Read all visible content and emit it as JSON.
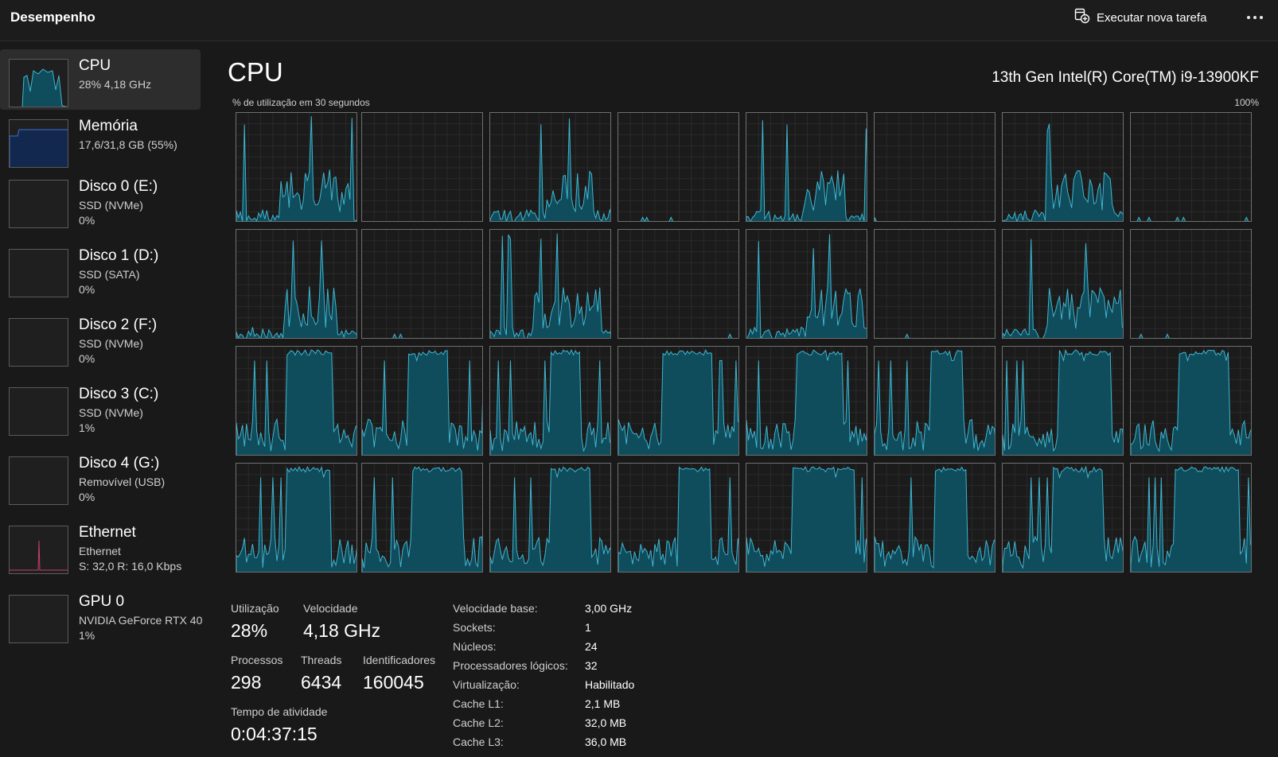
{
  "header": {
    "title": "Desempenho",
    "run_task_label": "Executar nova tarefa"
  },
  "sidebar": {
    "items": [
      {
        "title": "CPU",
        "lines": [
          "28%  4,18 GHz"
        ],
        "selected": true,
        "kind": "cpu"
      },
      {
        "title": "Memória",
        "lines": [
          "17,6/31,8 GB (55%)"
        ],
        "kind": "mem"
      },
      {
        "title": "Disco 0 (E:)",
        "lines": [
          "SSD (NVMe)",
          "0%"
        ],
        "kind": "disk"
      },
      {
        "title": "Disco 1 (D:)",
        "lines": [
          "SSD (SATA)",
          "0%"
        ],
        "kind": "disk"
      },
      {
        "title": "Disco 2 (F:)",
        "lines": [
          "SSD (NVMe)",
          "0%"
        ],
        "kind": "disk"
      },
      {
        "title": "Disco 3 (C:)",
        "lines": [
          "SSD (NVMe)",
          "1%"
        ],
        "kind": "disk"
      },
      {
        "title": "Disco 4 (G:)",
        "lines": [
          "Removível (USB)",
          "0%"
        ],
        "kind": "disk"
      },
      {
        "title": "Ethernet",
        "lines": [
          "Ethernet",
          "S: 32,0  R: 16,0 Kbps"
        ],
        "kind": "net"
      },
      {
        "title": "GPU 0",
        "lines": [
          "NVIDIA GeForce RTX 40",
          "1%"
        ],
        "kind": "gpu"
      }
    ]
  },
  "main": {
    "title": "CPU",
    "model": "13th Gen Intel(R) Core(TM) i9-13900KF",
    "graph_caption": "% de utilização em 30 segundos",
    "graph_max": "100%",
    "core_graphs": {
      "count": 32,
      "columns": 8,
      "row_profiles": [
        "sparse",
        "sparse",
        "saturated",
        "saturated"
      ],
      "line_color": "#3fb6d1",
      "fill_color": "#0f4c5c"
    }
  },
  "stats": {
    "utilization": {
      "label": "Utilização",
      "value": "28%"
    },
    "speed": {
      "label": "Velocidade",
      "value": "4,18 GHz"
    },
    "processes": {
      "label": "Processos",
      "value": "298"
    },
    "threads": {
      "label": "Threads",
      "value": "6434"
    },
    "handles": {
      "label": "Identificadores",
      "value": "160045"
    },
    "uptime": {
      "label": "Tempo de atividade",
      "value": "0:04:37:15"
    },
    "specs": [
      {
        "label": "Velocidade base:",
        "value": "3,00 GHz"
      },
      {
        "label": "Sockets:",
        "value": "1"
      },
      {
        "label": "Núcleos:",
        "value": "24"
      },
      {
        "label": "Processadores lógicos:",
        "value": "32"
      },
      {
        "label": "Virtualização:",
        "value": "Habilitado"
      },
      {
        "label": "Cache L1:",
        "value": "2,1 MB"
      },
      {
        "label": "Cache L2:",
        "value": "32,0 MB"
      },
      {
        "label": "Cache L3:",
        "value": "36,0 MB"
      }
    ]
  },
  "colors": {
    "background": "#191919",
    "selected": "#2d2d2d",
    "cpu_line": "#3fb6d1",
    "memory_line": "#3f6fc8",
    "network_line": "#c0406a"
  }
}
